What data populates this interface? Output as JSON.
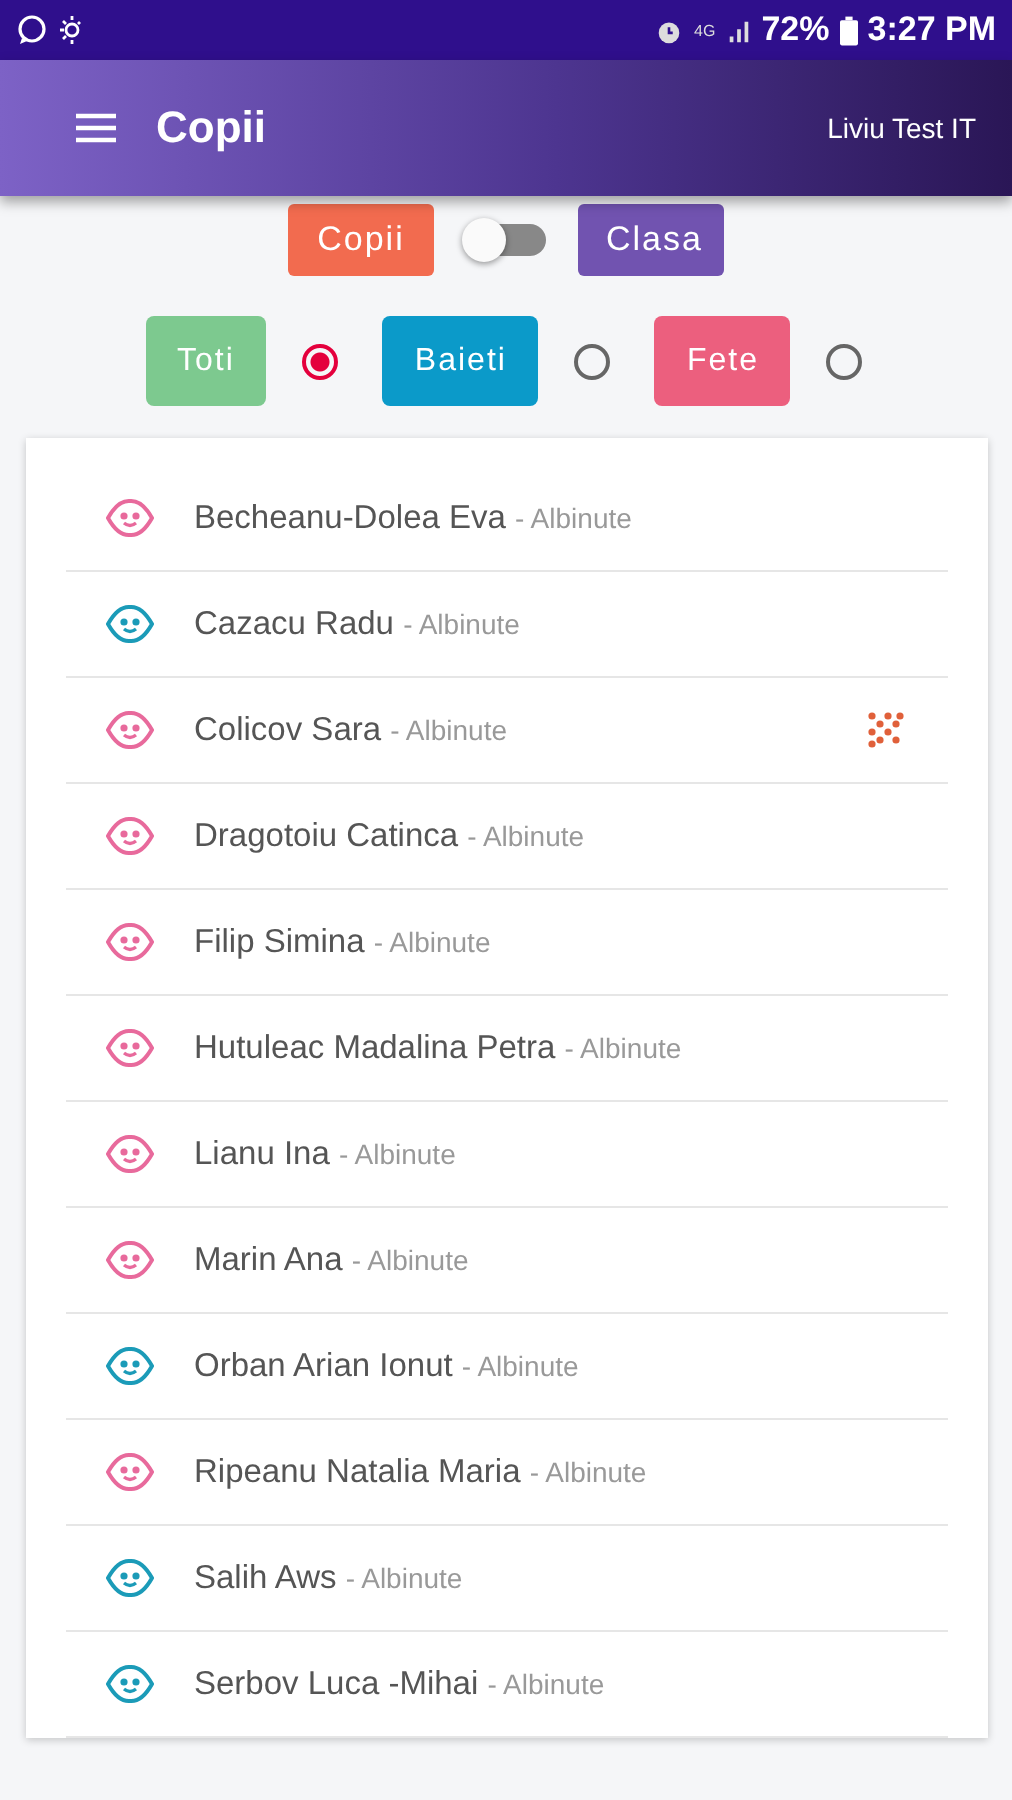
{
  "status_bar": {
    "battery": "72%",
    "time": "3:27 PM",
    "network": "4G"
  },
  "app_bar": {
    "title": "Copii",
    "user": "Liviu Test IT"
  },
  "view_toggle": {
    "left": "Copii",
    "right": "Clasa",
    "on": false
  },
  "filters": [
    {
      "label": "Toti",
      "color": "#7dc98f",
      "selected": true
    },
    {
      "label": "Baieti",
      "color": "#0b9ac9",
      "selected": false
    },
    {
      "label": "Fete",
      "color": "#ec5f7e",
      "selected": false
    }
  ],
  "children": [
    {
      "name": "Becheanu-Dolea Eva",
      "group": "- Albinute",
      "color": "#e86a9c",
      "flagged": false
    },
    {
      "name": "Cazacu Radu",
      "group": "- Albinute",
      "color": "#1b9bb8",
      "flagged": false
    },
    {
      "name": "Colicov Sara",
      "group": "- Albinute",
      "color": "#e86a9c",
      "flagged": true
    },
    {
      "name": "Dragotoiu Catinca",
      "group": "- Albinute",
      "color": "#e86a9c",
      "flagged": false
    },
    {
      "name": "Filip Simina",
      "group": "- Albinute",
      "color": "#e86a9c",
      "flagged": false
    },
    {
      "name": "Hutuleac Madalina Petra",
      "group": "- Albinute",
      "color": "#e86a9c",
      "flagged": false
    },
    {
      "name": "Lianu Ina",
      "group": "- Albinute",
      "color": "#e86a9c",
      "flagged": false
    },
    {
      "name": "Marin Ana",
      "group": "- Albinute",
      "color": "#e86a9c",
      "flagged": false
    },
    {
      "name": "Orban Arian Ionut",
      "group": "- Albinute",
      "color": "#1b9bb8",
      "flagged": false
    },
    {
      "name": "Ripeanu Natalia Maria",
      "group": "- Albinute",
      "color": "#e86a9c",
      "flagged": false
    },
    {
      "name": "Salih Aws",
      "group": "- Albinute",
      "color": "#1b9bb8",
      "flagged": false
    },
    {
      "name": "Serbov Luca -Mihai",
      "group": "- Albinute",
      "color": "#1b9bb8",
      "flagged": false
    }
  ]
}
